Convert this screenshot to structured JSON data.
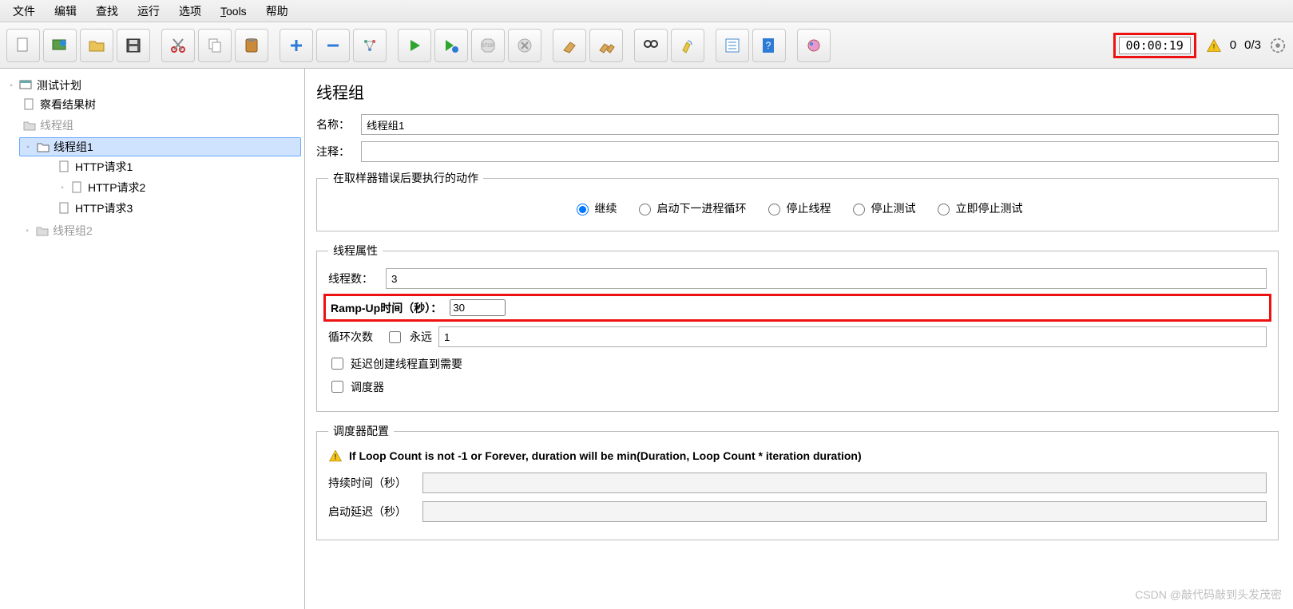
{
  "menu": {
    "file": "文件",
    "edit": "编辑",
    "search": "查找",
    "run": "运行",
    "options": "选项",
    "tools": "Tools",
    "help": "帮助"
  },
  "toolbar": {
    "icons": [
      "new",
      "templates",
      "open",
      "save",
      "cut",
      "copy",
      "paste",
      "plus",
      "minus",
      "wand",
      "start",
      "start-no-pause",
      "stop",
      "shutdown",
      "clear",
      "clear-all",
      "find",
      "reset",
      "toggle",
      "help-q",
      "fn"
    ],
    "time": "00:00:19",
    "warn_count": "0",
    "threads": "0/3"
  },
  "tree": {
    "root": "测试计划",
    "view_results": "察看结果树",
    "tg0": "线程组",
    "tg1": "线程组1",
    "http1": "HTTP请求1",
    "http2": "HTTP请求2",
    "http3": "HTTP请求3",
    "tg2": "线程组2"
  },
  "panel": {
    "title": "线程组",
    "name_label": "名称：",
    "name_value": "线程组1",
    "comment_label": "注释：",
    "comment_value": "",
    "onerror_legend": "在取样器错误后要执行的动作",
    "radios": {
      "continue": "继续",
      "next_loop": "启动下一进程循环",
      "stop_thread": "停止线程",
      "stop_test": "停止测试",
      "stop_now": "立即停止测试"
    },
    "props_legend": "线程属性",
    "threads_label": "线程数：",
    "threads_value": "3",
    "rampup_label": "Ramp-Up时间（秒）：",
    "rampup_value": "30",
    "loop_label": "循环次数",
    "forever_label": "永远",
    "loop_value": "1",
    "delay_create": "延迟创建线程直到需要",
    "scheduler_label": "调度器",
    "sched_legend": "调度器配置",
    "sched_warn": "If Loop Count is not -1 or Forever, duration will be min(Duration, Loop Count * iteration duration)",
    "duration_label": "持续时间（秒）",
    "startup_delay_label": "启动延迟（秒）"
  },
  "watermark": "CSDN @敲代码敲到头发茂密"
}
